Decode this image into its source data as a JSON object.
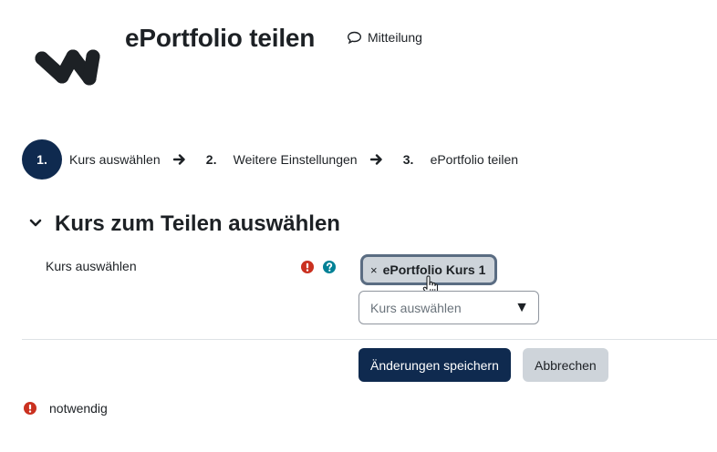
{
  "header": {
    "title": "ePortfolio teilen",
    "message_link": "Mitteilung",
    "logo_icon": "moodle-w-logo",
    "message_icon": "speech-bubble-icon"
  },
  "stepper": {
    "steps": [
      {
        "number": "1.",
        "label": "Kurs auswählen",
        "active": true
      },
      {
        "number": "2.",
        "label": "Weitere Einstellungen",
        "active": false
      },
      {
        "number": "3.",
        "label": "ePortfolio teilen",
        "active": false
      }
    ]
  },
  "section": {
    "title": "Kurs zum Teilen auswählen",
    "expanded": true
  },
  "form": {
    "field_label": "Kurs auswählen",
    "selected_chip": {
      "remove": "×",
      "label": "ePortfolio Kurs 1"
    },
    "select_placeholder": "Kurs auswählen",
    "select_caret": "▼"
  },
  "buttons": {
    "save": "Änderungen speichern",
    "cancel": "Abbrechen"
  },
  "footer": {
    "required_text": "notwendig"
  },
  "colors": {
    "primary": "#0f2a4f",
    "required": "#ca3120",
    "help": "#008196",
    "chip_bg": "#ced4da"
  }
}
